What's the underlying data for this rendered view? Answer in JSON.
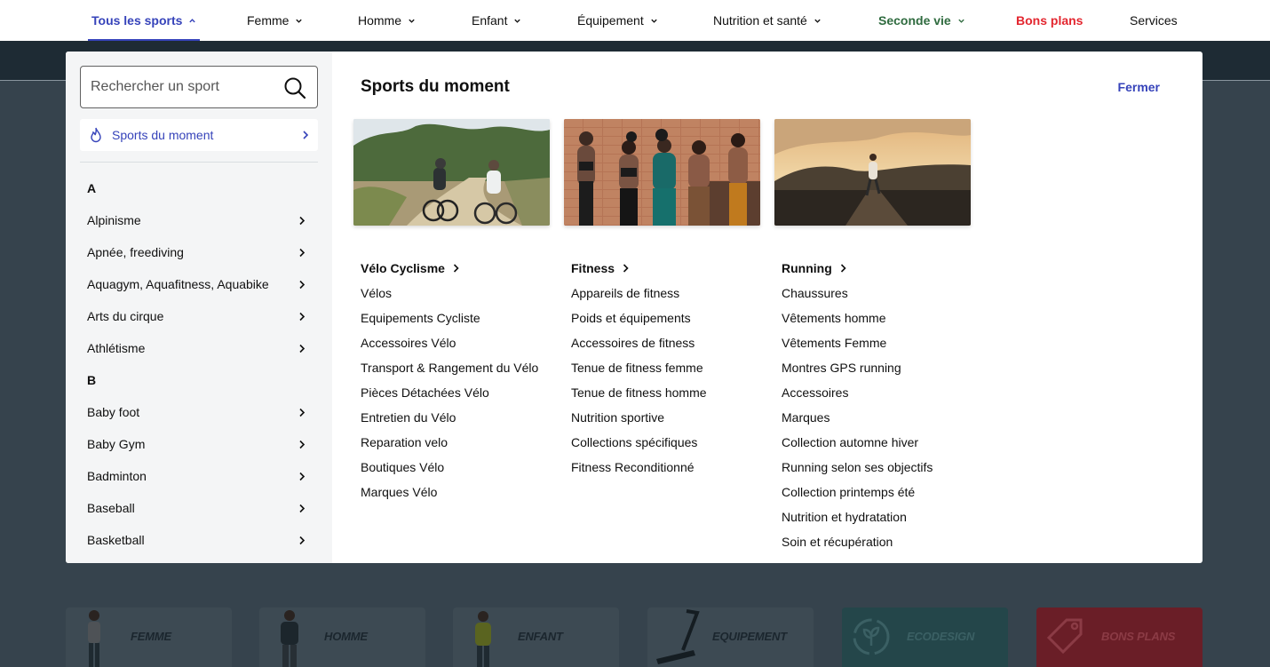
{
  "nav": {
    "items": [
      {
        "label": "Tous les sports"
      },
      {
        "label": "Femme"
      },
      {
        "label": "Homme"
      },
      {
        "label": "Enfant"
      },
      {
        "label": "Équipement"
      },
      {
        "label": "Nutrition et santé"
      },
      {
        "label": "Seconde vie"
      },
      {
        "label": "Bons plans"
      },
      {
        "label": "Services"
      }
    ],
    "colors": {
      "active": "#3643ba",
      "green": "#2f6b3f",
      "red": "#e3262f"
    }
  },
  "menu": {
    "search": {
      "placeholder": "Rechercher un sport",
      "icon": "search-icon"
    },
    "moment_label": "Sports du moment",
    "title": "Sports du moment",
    "close_label": "Fermer",
    "groups": [
      {
        "letter": "A",
        "sports": [
          "Alpinisme",
          "Apnée, freediving",
          "Aquagym, Aquafitness, Aquabike",
          "Arts du cirque",
          "Athlétisme"
        ]
      },
      {
        "letter": "B",
        "sports": [
          "Baby foot",
          "Baby Gym",
          "Badminton",
          "Baseball",
          "Basketball"
        ]
      }
    ],
    "columns": [
      {
        "heading": "Vélo Cyclisme",
        "image": "cycling-photo",
        "links": [
          "Vélos",
          "Equipements Cycliste",
          "Accessoires Vélo",
          "Transport & Rangement du Vélo",
          "Pièces Détachées Vélo",
          "Entretien du Vélo",
          "Reparation velo",
          "Boutiques Vélo",
          "Marques Vélo"
        ]
      },
      {
        "heading": "Fitness",
        "image": "fitness-photo",
        "links": [
          "Appareils de fitness",
          "Poids et équipements",
          "Accessoires de fitness",
          "Tenue de fitness femme",
          "Tenue de fitness homme",
          "Nutrition sportive",
          "Collections spécifiques",
          "Fitness Reconditionné"
        ]
      },
      {
        "heading": "Running",
        "image": "running-photo",
        "links": [
          "Chaussures",
          "Vêtements homme",
          "Vêtements Femme",
          "Montres GPS running",
          "Accessoires",
          "Marques",
          "Collection automne hiver",
          "Running selon ses objectifs",
          "Collection printemps été",
          "Nutrition et hydratation",
          "Soin et récupération"
        ]
      }
    ]
  },
  "categories": [
    {
      "label": "FEMME"
    },
    {
      "label": "HOMME"
    },
    {
      "label": "ENFANT"
    },
    {
      "label": "EQUIPEMENT"
    },
    {
      "label": "ECODESIGN"
    },
    {
      "label": "BONS PLANS"
    }
  ]
}
